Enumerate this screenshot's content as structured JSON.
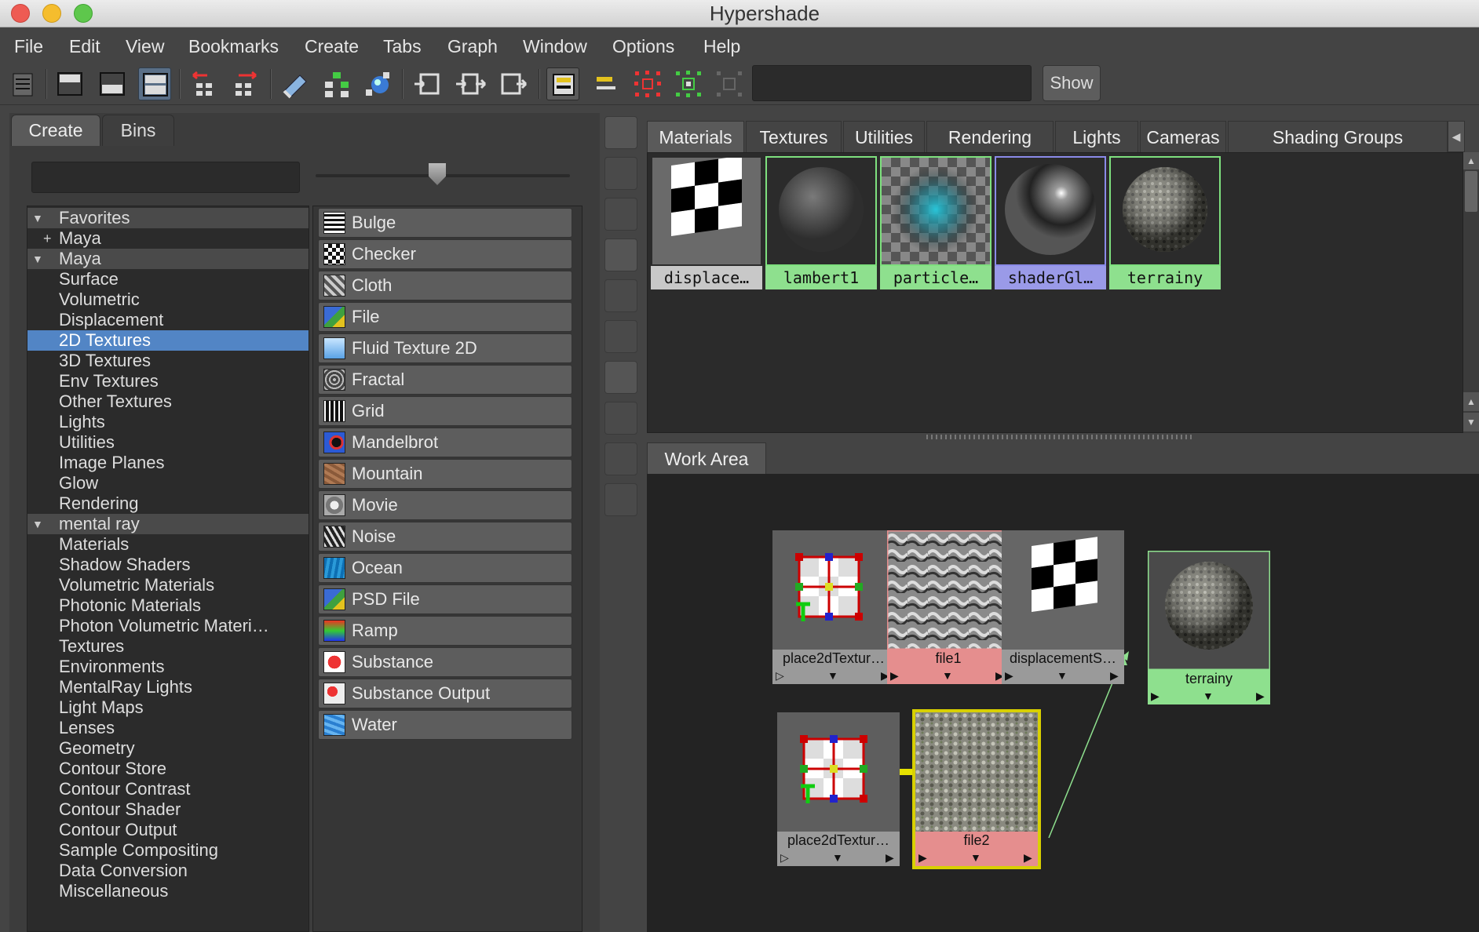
{
  "window": {
    "title": "Hypershade"
  },
  "menu": [
    "File",
    "Edit",
    "View",
    "Bookmarks",
    "Create",
    "Tabs",
    "Graph",
    "Window",
    "Options",
    "Help"
  ],
  "toolbar": {
    "icons": [
      "outliner-icon",
      "top-tabs-icon",
      "bottom-tabs-icon",
      "both-tabs-icon",
      "graph-left-icon",
      "graph-right-icon",
      "clear-graph-icon",
      "rearrange-icon",
      "graph-materials-icon",
      "input-connections-icon",
      "io-connections-icon",
      "output-connections-icon",
      "toggle-swatch-icon",
      "toggle-attr-icon",
      "select-upstream-icon",
      "select-downstream-icon",
      "hide-icon"
    ],
    "filter_value": "",
    "show_label": "Show"
  },
  "left_panel": {
    "tabs": [
      {
        "label": "Create",
        "active": true
      },
      {
        "label": "Bins",
        "active": false
      }
    ],
    "search_value": "",
    "tree": [
      {
        "label": "Favorites",
        "kind": "header",
        "expander": "▼"
      },
      {
        "label": "Maya",
        "kind": "collapsed",
        "expander": "+"
      },
      {
        "label": "Maya",
        "kind": "header",
        "expander": "▼"
      },
      {
        "label": "Surface",
        "kind": "item"
      },
      {
        "label": "Volumetric",
        "kind": "item"
      },
      {
        "label": "Displacement",
        "kind": "item"
      },
      {
        "label": "2D Textures",
        "kind": "selected"
      },
      {
        "label": "3D Textures",
        "kind": "item"
      },
      {
        "label": "Env Textures",
        "kind": "item"
      },
      {
        "label": "Other Textures",
        "kind": "item"
      },
      {
        "label": "Lights",
        "kind": "item"
      },
      {
        "label": "Utilities",
        "kind": "item"
      },
      {
        "label": "Image Planes",
        "kind": "item"
      },
      {
        "label": "Glow",
        "kind": "item"
      },
      {
        "label": "Rendering",
        "kind": "item"
      },
      {
        "label": "mental ray",
        "kind": "header",
        "expander": "▼"
      },
      {
        "label": "Materials",
        "kind": "item"
      },
      {
        "label": "Shadow Shaders",
        "kind": "item"
      },
      {
        "label": "Volumetric Materials",
        "kind": "item"
      },
      {
        "label": "Photonic Materials",
        "kind": "item"
      },
      {
        "label": "Photon Volumetric Materi…",
        "kind": "item"
      },
      {
        "label": "Textures",
        "kind": "item"
      },
      {
        "label": "Environments",
        "kind": "item"
      },
      {
        "label": "MentalRay Lights",
        "kind": "item"
      },
      {
        "label": "Light Maps",
        "kind": "item"
      },
      {
        "label": "Lenses",
        "kind": "item"
      },
      {
        "label": "Geometry",
        "kind": "item"
      },
      {
        "label": "Contour Store",
        "kind": "item"
      },
      {
        "label": "Contour Contrast",
        "kind": "item"
      },
      {
        "label": "Contour Shader",
        "kind": "item"
      },
      {
        "label": "Contour Output",
        "kind": "item"
      },
      {
        "label": "Sample Compositing",
        "kind": "item"
      },
      {
        "label": "Data Conversion",
        "kind": "item"
      },
      {
        "label": "Miscellaneous",
        "kind": "item"
      }
    ],
    "nodes": [
      {
        "label": "Bulge",
        "icon": "bulge-icon"
      },
      {
        "label": "Checker",
        "icon": "checker-icon"
      },
      {
        "label": "Cloth",
        "icon": "cloth-icon"
      },
      {
        "label": "File",
        "icon": "file-icon"
      },
      {
        "label": "Fluid Texture 2D",
        "icon": "fluid-texture-icon"
      },
      {
        "label": "Fractal",
        "icon": "fractal-icon"
      },
      {
        "label": "Grid",
        "icon": "grid-icon"
      },
      {
        "label": "Mandelbrot",
        "icon": "mandelbrot-icon"
      },
      {
        "label": "Mountain",
        "icon": "mountain-icon"
      },
      {
        "label": "Movie",
        "icon": "movie-icon"
      },
      {
        "label": "Noise",
        "icon": "noise-icon"
      },
      {
        "label": "Ocean",
        "icon": "ocean-icon"
      },
      {
        "label": "PSD File",
        "icon": "psd-file-icon"
      },
      {
        "label": "Ramp",
        "icon": "ramp-icon"
      },
      {
        "label": "Substance",
        "icon": "substance-icon"
      },
      {
        "label": "Substance Output",
        "icon": "substance-output-icon"
      },
      {
        "label": "Water",
        "icon": "water-icon"
      }
    ]
  },
  "right_panel": {
    "tabs": [
      "Materials",
      "Textures",
      "Utilities",
      "Rendering",
      "Lights",
      "Cameras",
      "Shading Groups"
    ],
    "active_tab": "Materials",
    "swatches": [
      {
        "name": "displace…",
        "kind": "checker",
        "label_color": "#c8c8c8",
        "border": "transparent"
      },
      {
        "name": "lambert1",
        "kind": "sphere-flat",
        "label_color": "#8ee08e",
        "border": "#7ee07e"
      },
      {
        "name": "particle…",
        "kind": "particle",
        "label_color": "#8ee08e",
        "border": "#7ee07e"
      },
      {
        "name": "shaderGl…",
        "kind": "sphere-shiny",
        "label_color": "#9a9ae8",
        "border": "#8a8ae8"
      },
      {
        "name": "terrainy",
        "kind": "sphere-rock",
        "label_color": "#8ee08e",
        "border": "#7ee07e"
      }
    ],
    "work_area_tab": "Work Area",
    "graph_nodes": [
      {
        "id": "place2d-1",
        "label": "place2dTextur…",
        "label_color": "#9a9a9a",
        "kind": "place2d"
      },
      {
        "id": "file1",
        "label": "file1",
        "label_color": "#e58e8e",
        "kind": "noise-map"
      },
      {
        "id": "displacement",
        "label": "displacementS…",
        "label_color": "#9a9a9a",
        "kind": "checker"
      },
      {
        "id": "terrainy",
        "label": "terrainy",
        "label_color": "#8ee08e",
        "kind": "sphere-rock"
      },
      {
        "id": "place2d-2",
        "label": "place2dTextur…",
        "label_color": "#9a9a9a",
        "kind": "place2d"
      },
      {
        "id": "file2",
        "label": "file2",
        "label_color": "#e58e8e",
        "kind": "rock-map"
      }
    ],
    "node_bar_glyphs": {
      "in": "▷",
      "in_filled": "▶",
      "menu": "▼",
      "out": "▶"
    }
  }
}
